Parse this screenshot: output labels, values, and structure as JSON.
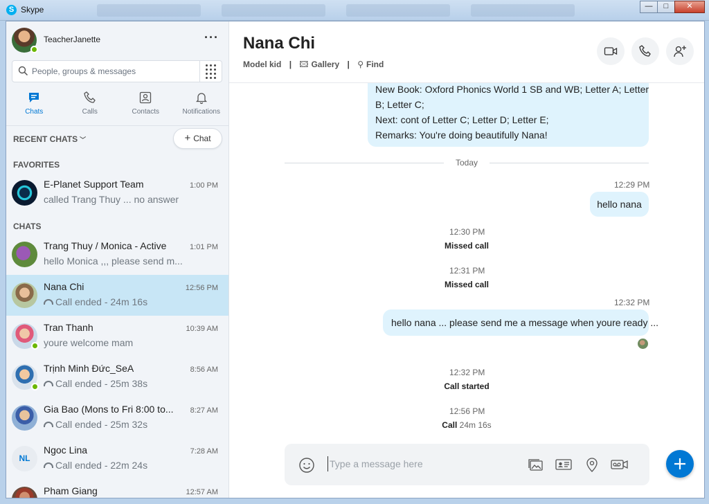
{
  "window": {
    "title": "Skype",
    "controls": {
      "minimize": "—",
      "maximize": "□",
      "close": "✕"
    }
  },
  "profile": {
    "name": "TeacherJanette",
    "more": "···"
  },
  "search": {
    "placeholder": "People, groups & messages"
  },
  "nav": [
    {
      "label": "Chats",
      "icon": "chat-icon",
      "active": true
    },
    {
      "label": "Calls",
      "icon": "phone-icon"
    },
    {
      "label": "Contacts",
      "icon": "contacts-icon"
    },
    {
      "label": "Notifications",
      "icon": "bell-icon"
    }
  ],
  "recent": {
    "label": "RECENT CHATS",
    "new_chat_label": "Chat"
  },
  "sections": {
    "favorites": "FAVORITES",
    "chats": "CHATS"
  },
  "favorites": [
    {
      "name": "E-Planet Support Team",
      "time": "1:00 PM",
      "snippet": "called Trang Thuy ... no answer"
    }
  ],
  "chats": [
    {
      "name": "Trang Thuy / Monica - Active",
      "time": "1:01 PM",
      "snippet": "hello Monica ,,, please send m..."
    },
    {
      "name": "Nana Chi",
      "time": "12:56 PM",
      "snippet": "Call ended - 24m 16s",
      "selected": true
    },
    {
      "name": "Tran Thanh",
      "time": "10:39 AM",
      "snippet": "youre welcome mam"
    },
    {
      "name": "Trịnh Minh Đức_SeA",
      "time": "8:56 AM",
      "snippet": "Call ended - 25m 38s"
    },
    {
      "name": "Gia Bao (Mons to Fri 8:00 to...",
      "time": "8:27 AM",
      "snippet": "Call ended - 25m 32s"
    },
    {
      "name": "Ngoc Lina",
      "time": "7:28 AM",
      "snippet": "Call ended - 22m 24s",
      "initials": "NL"
    },
    {
      "name": "Pham Giang",
      "time": "12:57 AM",
      "snippet": ""
    }
  ],
  "conversation": {
    "name": "Nana Chi",
    "mood": "Model kid",
    "gallery": "Gallery",
    "find": "Find",
    "separator": "|",
    "previous_message": [
      "New Book: Oxford Phonics World 1 SB and WB; Letter A; Letter",
      "B; Letter C;",
      "Next: cont of Letter C; Letter D; Letter E;",
      "Remarks: You're doing beautifully Nana!"
    ],
    "day_divider": "Today",
    "messages": [
      {
        "time": "12:29 PM",
        "text": "hello nana"
      },
      {
        "time": "12:32 PM",
        "text": "hello nana ... please send me a message when youre ready ..."
      }
    ],
    "events": [
      {
        "time": "12:30 PM",
        "label": "Missed call"
      },
      {
        "time": "12:31 PM",
        "label": "Missed call"
      },
      {
        "time": "12:32 PM",
        "label": "Call started"
      },
      {
        "time": "12:56 PM",
        "label": "Call",
        "duration": "24m 16s"
      }
    ]
  },
  "composer": {
    "placeholder": "Type a message here"
  },
  "colors": {
    "accent": "#0078d4",
    "skype": "#00aff0",
    "selected": "#c8e6f6",
    "bubble": "#dff3fd",
    "online": "#6bb700"
  }
}
